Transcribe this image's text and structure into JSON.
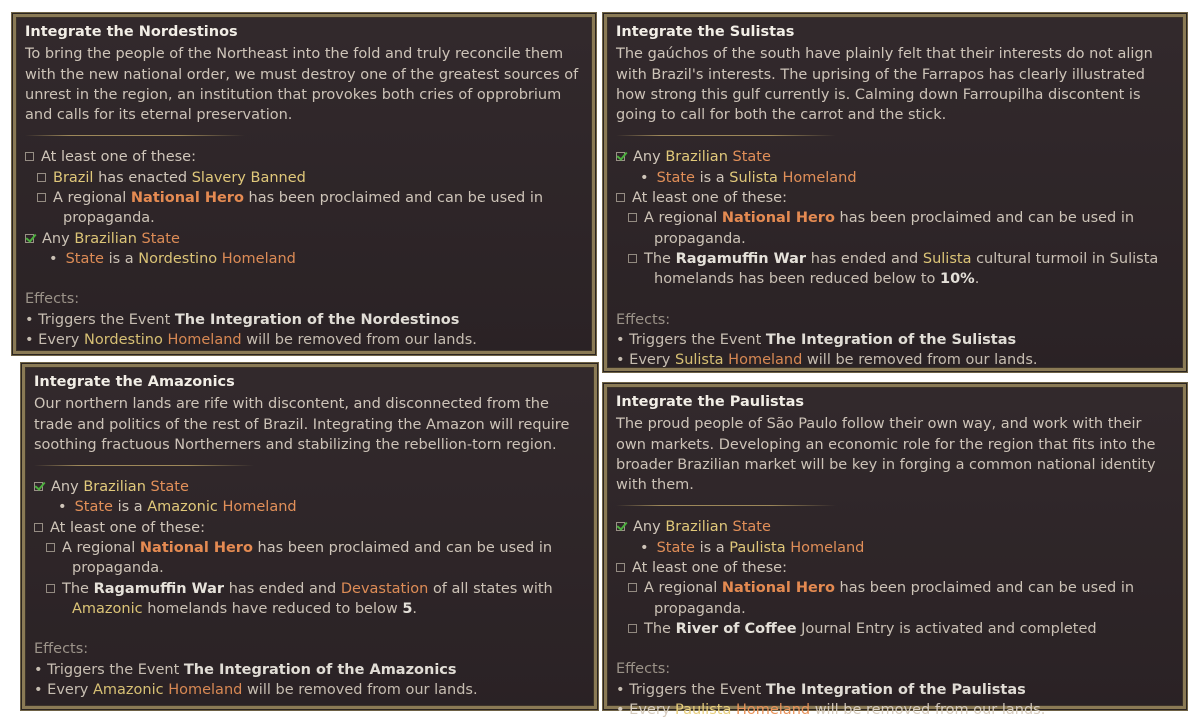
{
  "common": {
    "any": "Any",
    "brazilian": "Brazilian",
    "state": "State",
    "is_a": "is a",
    "homeland": "Homeland",
    "at_least": "At least one of these:",
    "a_regional": "A regional",
    "national_hero": "National Hero",
    "hero_rest_1": "has been proclaimed and can be used in",
    "hero_rest_2": "propaganda.",
    "the": "The",
    "ragamuffin": "Ragamuffin War",
    "has_ended_and": "has ended and",
    "effects": "Effects:",
    "triggers": "• Triggers the Event",
    "every": "• Every",
    "removed": "will be removed from our lands."
  },
  "panels": [
    {
      "title": "Integrate the Nordestinos",
      "description": "To bring the people of the Northeast into the fold and truly reconcile them with the new national order, we must destroy one of the greatest sources of unrest in the region, an institution that provokes both cries of opprobrium and calls for its eternal preservation.",
      "brazil": "Brazil",
      "has_enacted": "has enacted",
      "slavery_banned": "Slavery Banned",
      "culture": "Nordestino",
      "event": "The Integration of the Nordestinos"
    },
    {
      "title": "Integrate the Sulistas",
      "description": "The gaúchos of the south have plainly felt that their interests do not align with Brazil's interests. The uprising of the Farrapos has clearly illustrated how strong this gulf currently is. Calming down Farroupilha discontent is going to call for both the carrot and the stick.",
      "culture": "Sulista",
      "turmoil_rest_1": "cultural turmoil in Sulista",
      "turmoil_rest_2": "homelands has been reduced below to",
      "turmoil_value": "10%",
      "event": "The Integration of the Sulistas"
    },
    {
      "title": "Integrate the Amazonics",
      "description": "Our northern lands are rife with discontent, and disconnected from the trade and politics of the rest of Brazil. Integrating the Amazon will require soothing fractuous Northerners and stabilizing the rebellion-torn region.",
      "culture": "Amazonic",
      "devastation": "Devastation",
      "dev_rest_1": "of all states with",
      "dev_rest_2": "homelands have reduced to below",
      "dev_value": "5",
      "event": "The Integration of the Amazonics"
    },
    {
      "title": "Integrate the Paulistas",
      "description": "The proud people of São Paulo follow their own way, and work with their own markets. Developing an economic role for the region that fits into the broader Brazilian market will be key in forging a common national identity with them.",
      "culture": "Paulista",
      "river": "River of Coffee",
      "river_rest": "Journal Entry is activated and completed",
      "event": "The Integration of the Paulistas"
    }
  ]
}
